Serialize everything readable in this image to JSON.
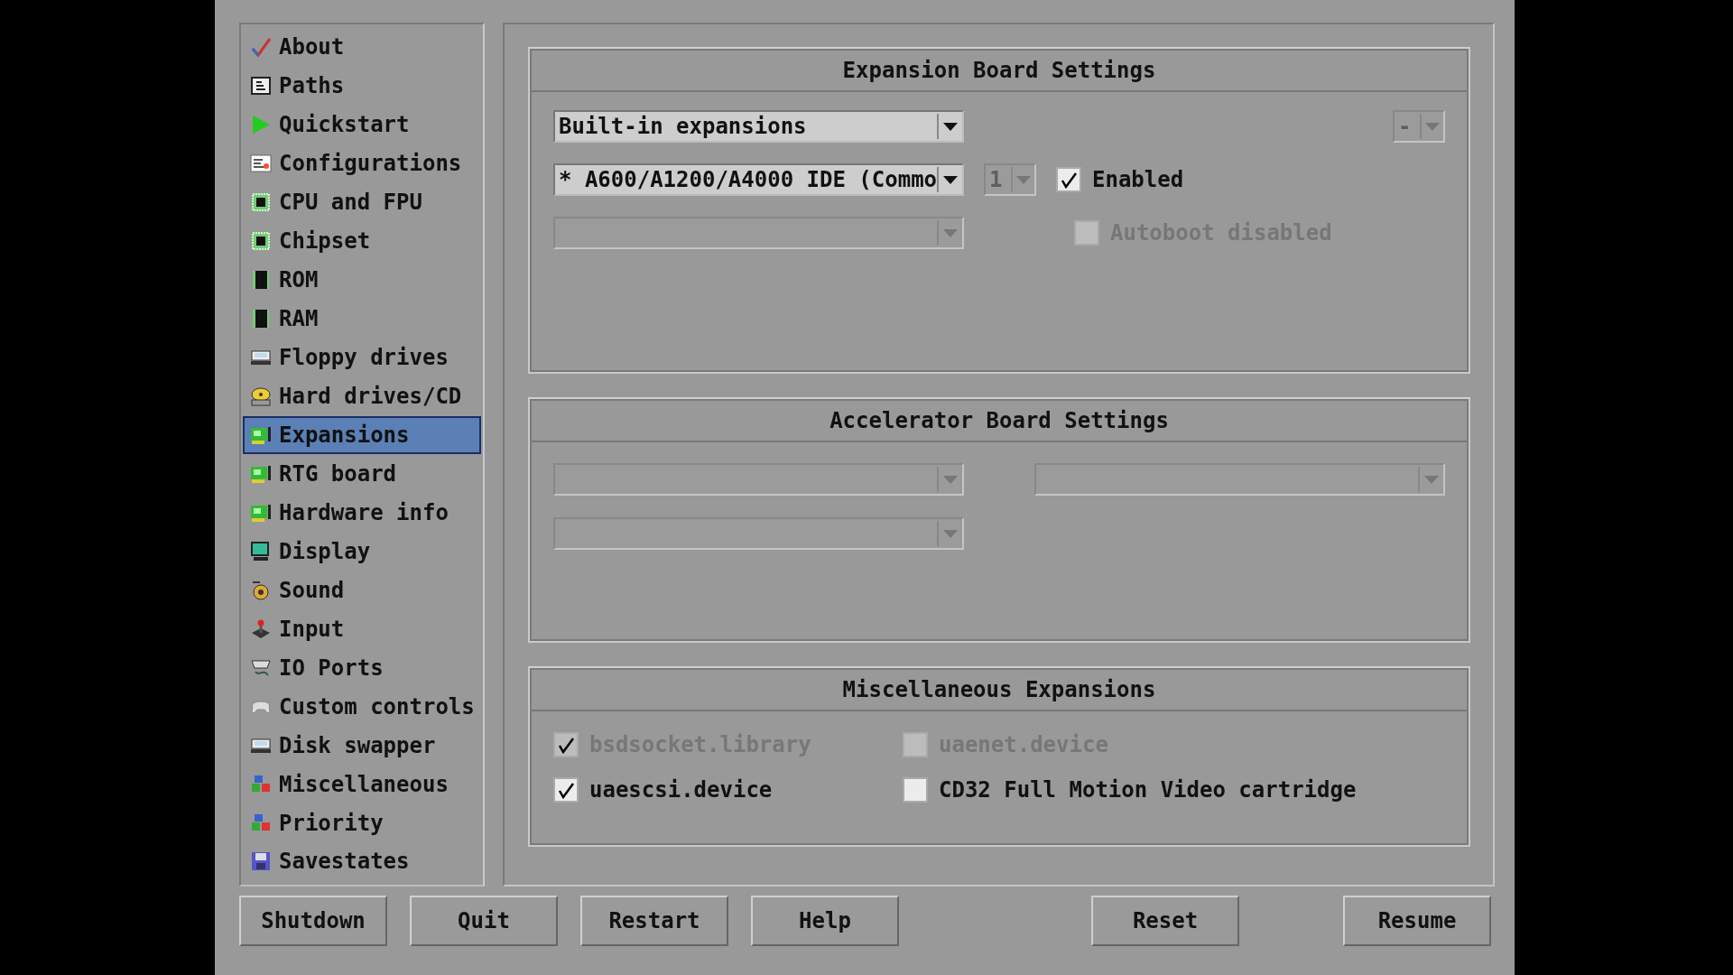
{
  "sidebar": {
    "items": [
      {
        "label": "About",
        "selected": false
      },
      {
        "label": "Paths",
        "selected": false
      },
      {
        "label": "Quickstart",
        "selected": false
      },
      {
        "label": "Configurations",
        "selected": false
      },
      {
        "label": "CPU and FPU",
        "selected": false
      },
      {
        "label": "Chipset",
        "selected": false
      },
      {
        "label": "ROM",
        "selected": false
      },
      {
        "label": "RAM",
        "selected": false
      },
      {
        "label": "Floppy drives",
        "selected": false
      },
      {
        "label": "Hard drives/CD",
        "selected": false
      },
      {
        "label": "Expansions",
        "selected": true
      },
      {
        "label": "RTG board",
        "selected": false
      },
      {
        "label": "Hardware info",
        "selected": false
      },
      {
        "label": "Display",
        "selected": false
      },
      {
        "label": "Sound",
        "selected": false
      },
      {
        "label": "Input",
        "selected": false
      },
      {
        "label": "IO Ports",
        "selected": false
      },
      {
        "label": "Custom controls",
        "selected": false
      },
      {
        "label": "Disk swapper",
        "selected": false
      },
      {
        "label": "Miscellaneous",
        "selected": false
      },
      {
        "label": "Priority",
        "selected": false
      },
      {
        "label": "Savestates",
        "selected": false
      }
    ]
  },
  "expansion_board": {
    "title": "Expansion Board Settings",
    "category_dropdown": {
      "value": "Built-in expansions",
      "disabled": false
    },
    "board_dropdown": {
      "value": "* A600/A1200/A4000 IDE (Commo",
      "disabled": false
    },
    "sub_dropdown": {
      "disabled": true
    },
    "unit_dropdown": {
      "value": "1",
      "disabled": true
    },
    "extra_dropdown": {
      "value": "-",
      "disabled": true
    },
    "checkboxes": [
      {
        "label": "Enabled",
        "checked": true,
        "disabled": false
      },
      {
        "label": "Autoboot disabled",
        "checked": false,
        "disabled": true
      }
    ]
  },
  "accelerator_board": {
    "title": "Accelerator Board Settings",
    "dropdowns": [
      {
        "disabled": true
      },
      {
        "disabled": true
      },
      {
        "disabled": true
      }
    ]
  },
  "misc_expansions": {
    "title": "Miscellaneous Expansions",
    "checkboxes": [
      {
        "label": "bsdsocket.library",
        "checked": true,
        "disabled": true
      },
      {
        "label": "uaenet.device",
        "checked": false,
        "disabled": true
      },
      {
        "label": "uaescsi.device",
        "checked": true,
        "disabled": false
      },
      {
        "label": "CD32 Full Motion Video cartridge",
        "checked": false,
        "disabled": false
      }
    ]
  },
  "left_buttons": [
    "Shutdown",
    "Quit",
    "Restart",
    "Help"
  ],
  "right_buttons": [
    "Reset",
    "Resume"
  ]
}
